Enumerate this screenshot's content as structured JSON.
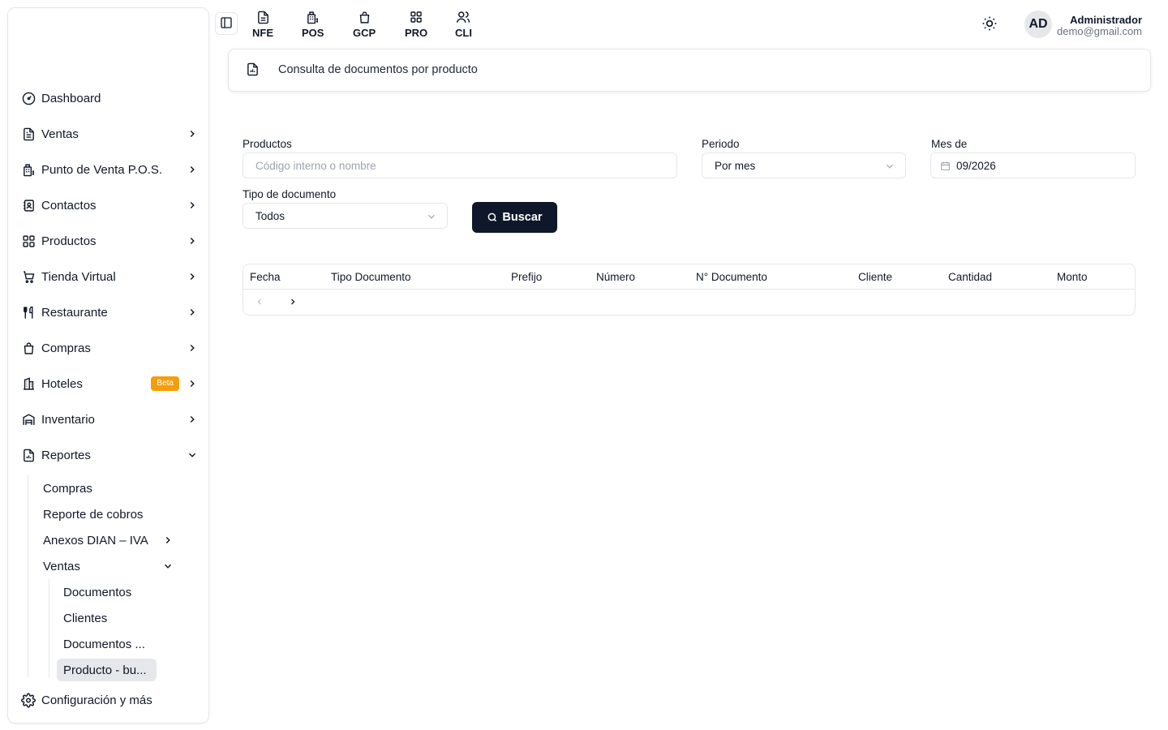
{
  "sidebar": {
    "items": [
      {
        "label": "Dashboard",
        "icon": "gauge-icon",
        "chevron": "none"
      },
      {
        "label": "Ventas",
        "icon": "document-icon",
        "chevron": "right"
      },
      {
        "label": "Punto de Venta P.O.S.",
        "icon": "pos-icon",
        "chevron": "right"
      },
      {
        "label": "Contactos",
        "icon": "contacts-icon",
        "chevron": "right"
      },
      {
        "label": "Productos",
        "icon": "grid-icon",
        "chevron": "right"
      },
      {
        "label": "Tienda Virtual",
        "icon": "cart-icon",
        "chevron": "right"
      },
      {
        "label": "Restaurante",
        "icon": "utensils-icon",
        "chevron": "right"
      },
      {
        "label": "Compras",
        "icon": "bag-icon",
        "chevron": "right"
      },
      {
        "label": "Hoteles",
        "icon": "building-icon",
        "chevron": "right",
        "badge": "Beta"
      },
      {
        "label": "Inventario",
        "icon": "warehouse-icon",
        "chevron": "right"
      },
      {
        "label": "Reportes",
        "icon": "report-icon",
        "chevron": "down"
      }
    ],
    "reportes_sub": [
      {
        "label": "Compras"
      },
      {
        "label": "Reporte de cobros"
      },
      {
        "label": "Anexos DIAN – IVA"
      },
      {
        "label": "Ventas"
      }
    ],
    "ventas_sub": [
      {
        "label": "Documentos"
      },
      {
        "label": "Clientes"
      },
      {
        "label": "Documentos ..."
      },
      {
        "label": "Producto - bu..."
      }
    ],
    "footer": {
      "label": "Configuración y más",
      "icon": "gear-icon"
    }
  },
  "topbar": {
    "modules": [
      {
        "label": "NFE",
        "icon": "file-icon"
      },
      {
        "label": "POS",
        "icon": "pos-icon"
      },
      {
        "label": "GCP",
        "icon": "bag-icon"
      },
      {
        "label": "PRO",
        "icon": "grid-icon"
      },
      {
        "label": "CLI",
        "icon": "users-icon"
      }
    ],
    "user": {
      "initials": "AD",
      "name": "Administrador",
      "email": "demo@gmail.com"
    }
  },
  "page": {
    "title": "Consulta de documentos por producto"
  },
  "form": {
    "productos_label": "Productos",
    "productos_placeholder": "Código interno o nombre",
    "periodo_label": "Periodo",
    "periodo_value": "Por mes",
    "mes_label": "Mes de",
    "mes_value": "09/2026",
    "tipo_label": "Tipo de documento",
    "tipo_value": "Todos",
    "search_label": "Buscar"
  },
  "table": {
    "columns": [
      "Fecha",
      "Tipo Documento",
      "Prefijo",
      "Número",
      "N° Documento",
      "Cliente",
      "Cantidad",
      "Monto"
    ],
    "rows": []
  },
  "colors": {
    "primary_button": "#0f172a",
    "badge": "#f59e0b",
    "border": "#e5e7eb"
  }
}
